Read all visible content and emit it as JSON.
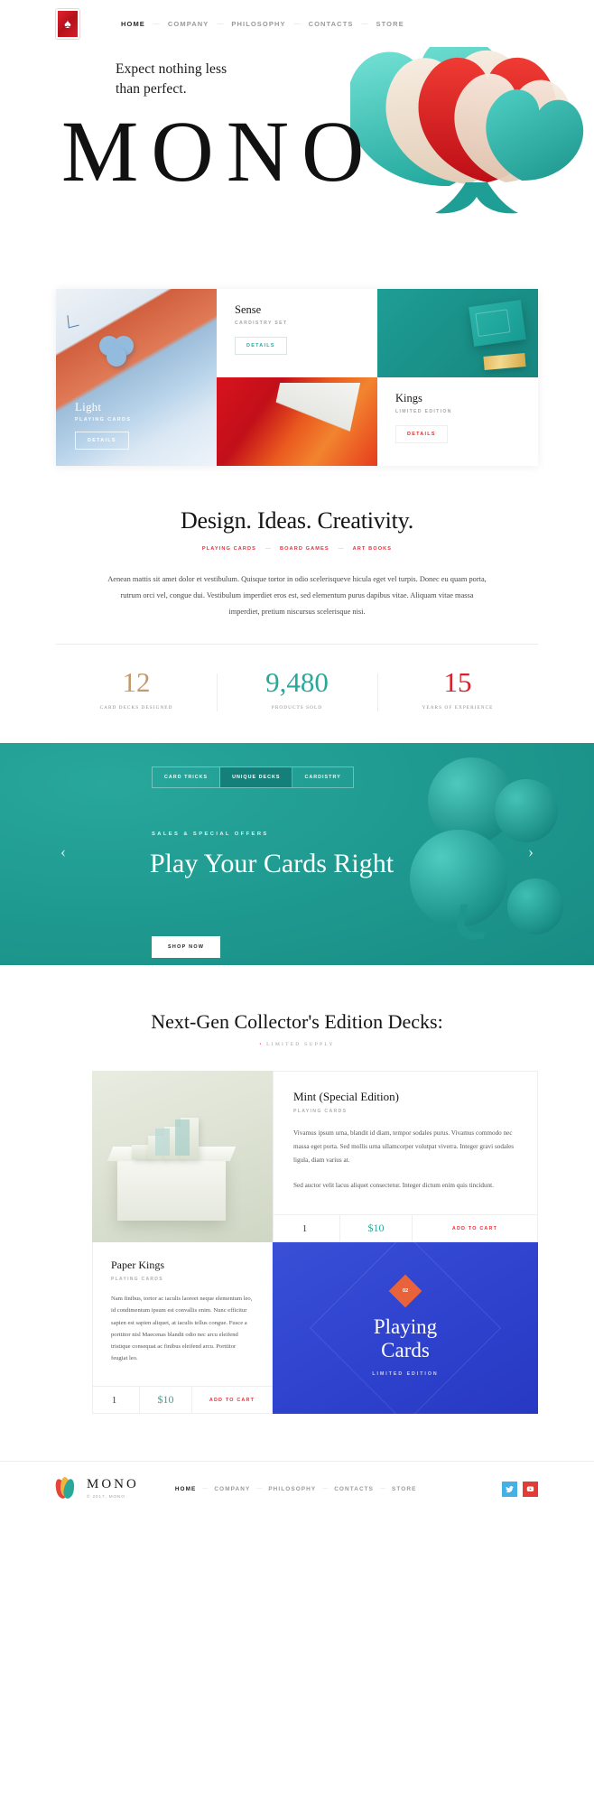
{
  "header": {
    "logo_icon": "spade-icon",
    "nav": [
      {
        "label": "HOME",
        "active": true
      },
      {
        "label": "COMPANY",
        "active": false
      },
      {
        "label": "PHILOSOPHY",
        "active": false
      },
      {
        "label": "CONTACTS",
        "active": false
      },
      {
        "label": "STORE",
        "active": false
      }
    ]
  },
  "hero": {
    "tagline_line1": "Expect nothing less",
    "tagline_line2": "than perfect.",
    "wordmark": "MONO"
  },
  "products": {
    "light": {
      "title": "Light",
      "subtitle": "PLAYING CARDS",
      "cta": "DETAILS"
    },
    "sense": {
      "title": "Sense",
      "subtitle": "CARDISTRY SET",
      "cta": "DETAILS"
    },
    "kings": {
      "title": "Kings",
      "subtitle": "LIMITED EDITION",
      "cta": "DETAILS"
    }
  },
  "about": {
    "heading": "Design. Ideas. Creativity.",
    "categories": [
      "PLAYING CARDS",
      "BOARD GAMES",
      "ART BOOKS"
    ],
    "paragraph": "Aenean mattis sit amet dolor et vestibulum. Quisque tortor in odio scelerisqueve hicula eget vel turpis. Donec eu quam porta, rutrum orci vel, congue dui. Vestibulum imperdiet eros est, sed elementum purus dapibus vitae. Aliquam vitae massa imperdiet, pretium niscursus scelerisque nisi."
  },
  "stats": [
    {
      "value": "12",
      "label": "CARD DECKS DESIGNED",
      "color": "#c49a6c"
    },
    {
      "value": "9,480",
      "label": "PRODUCTS SOLD",
      "color": "#2aa79b"
    },
    {
      "value": "15",
      "label": "YEARS OF EXPERIENCE",
      "color": "#d8212c"
    }
  ],
  "banner": {
    "tabs": [
      {
        "label": "CARD TRICKS",
        "active": false
      },
      {
        "label": "UNIQUE DECKS",
        "active": true
      },
      {
        "label": "CARDISTRY",
        "active": false
      }
    ],
    "eyebrow": "SALES & SPECIAL OFFERS",
    "heading": "Play Your Cards Right",
    "cta": "SHOP NOW",
    "prev_icon": "chevron-left-icon",
    "next_icon": "chevron-right-icon"
  },
  "collector": {
    "heading": "Next-Gen Collector's Edition Decks:",
    "limited_label": "LIMITED SUPPLY",
    "mint": {
      "title": "Mint (Special Edition)",
      "kicker": "PLAYING CARDS",
      "paragraph1": "Vivamus ipsum urna, blandit id diam, tempor sodales purus. Vivamus commodo nec massa eget porta. Sed mollis urna ullamcorper volutpat viverra. Integer gravi sodales ligula, diam varius at.",
      "paragraph2": "Sed auctor velit lacus aliquet consectetur. Integer dictum enim quis tincidunt.",
      "quantity": "1",
      "price": "$10",
      "add_to_cart": "ADD TO CART"
    },
    "paper_kings": {
      "title": "Paper Kings",
      "kicker": "PLAYING CARDS",
      "paragraph": "Nam finibus, tortor ac iaculis laoreet neque elementum leo, id condimentum ipsum est convallis enim. Nunc efficitur sapien est sapien aliquet, at iaculis tellus congue. Fusce a porttitor nisl Maecenas blandit odio nec arcu eleifend tristique consequat ac finibus eleifend arcu. Porttitor feugiat leo.",
      "quantity": "1",
      "price": "$10",
      "add_to_cart": "ADD TO CART"
    },
    "playing_cards": {
      "badge": "02",
      "title_line1": "Playing",
      "title_line2": "Cards",
      "subtitle": "LIMITED EDITION"
    }
  },
  "footer": {
    "brand": "MONO",
    "copyright": "© 2017, MONO",
    "nav": [
      {
        "label": "HOME",
        "active": true
      },
      {
        "label": "COMPANY",
        "active": false
      },
      {
        "label": "PHILOSOPHY",
        "active": false
      },
      {
        "label": "CONTACTS",
        "active": false
      },
      {
        "label": "STORE",
        "active": false
      }
    ],
    "socials": [
      {
        "name": "twitter-icon",
        "glyph": "t",
        "color": "#45b0e3"
      },
      {
        "name": "youtube-icon",
        "glyph": "▶",
        "color": "#e33b36"
      }
    ]
  }
}
